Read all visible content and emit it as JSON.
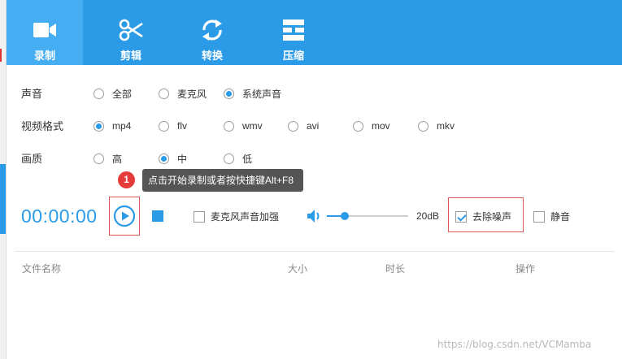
{
  "toolbar": {
    "items": [
      {
        "label": "录制",
        "icon": "video-camera-icon",
        "active": true
      },
      {
        "label": "剪辑",
        "icon": "scissors-icon",
        "active": false
      },
      {
        "label": "转换",
        "icon": "refresh-icon",
        "active": false
      },
      {
        "label": "压缩",
        "icon": "compress-icon",
        "active": false
      }
    ],
    "accent": "#2b9be8"
  },
  "settings": {
    "sound": {
      "label": "声音",
      "options": [
        "全部",
        "麦克风",
        "系统声音"
      ],
      "selected": "系统声音"
    },
    "format": {
      "label": "视频格式",
      "options": [
        "mp4",
        "flv",
        "wmv",
        "avi",
        "mov",
        "mkv"
      ],
      "selected": "mp4"
    },
    "quality": {
      "label": "画质",
      "options": [
        "高",
        "中",
        "低"
      ],
      "selected": "中"
    }
  },
  "tooltip": {
    "badge": "1",
    "text": "点击开始录制或者按快捷键Alt+F8"
  },
  "controls": {
    "timer": "00:00:00",
    "mic_boost": {
      "label": "麦克风声音加强",
      "checked": false
    },
    "volume": {
      "value_label": "20dB",
      "fraction": 0.22
    },
    "denoise": {
      "label": "去除噪声",
      "checked": true
    },
    "mute": {
      "label": "静音",
      "checked": false
    }
  },
  "file_table": {
    "columns": [
      "文件名称",
      "大小",
      "时长",
      "操作"
    ]
  },
  "watermark": "https://blog.csdn.net/VCMamba"
}
